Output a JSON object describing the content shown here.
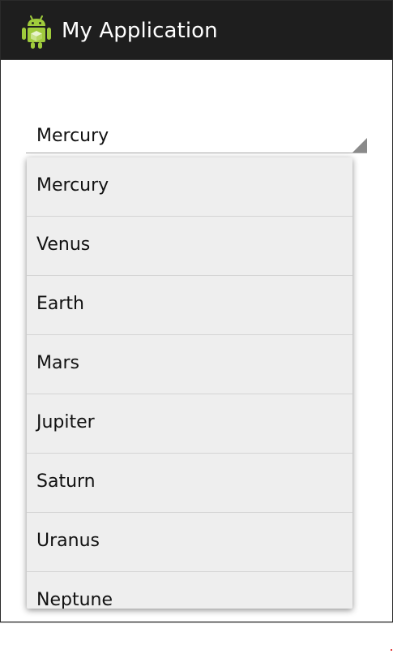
{
  "action_bar": {
    "title": "My Application",
    "icon": "android-robot-icon",
    "background": "#1e1e1e",
    "icon_color": "#9fcb3c"
  },
  "spinner": {
    "selected_value": "Mercury",
    "arrow_icon": "dropdown-triangle-icon"
  },
  "dropdown": {
    "options": [
      {
        "label": "Mercury"
      },
      {
        "label": "Venus"
      },
      {
        "label": "Earth"
      },
      {
        "label": "Mars"
      },
      {
        "label": "Jupiter"
      },
      {
        "label": "Saturn"
      },
      {
        "label": "Uranus"
      },
      {
        "label": "Neptune"
      }
    ],
    "background": "#eeeeee",
    "divider": "#d4d4d4"
  }
}
